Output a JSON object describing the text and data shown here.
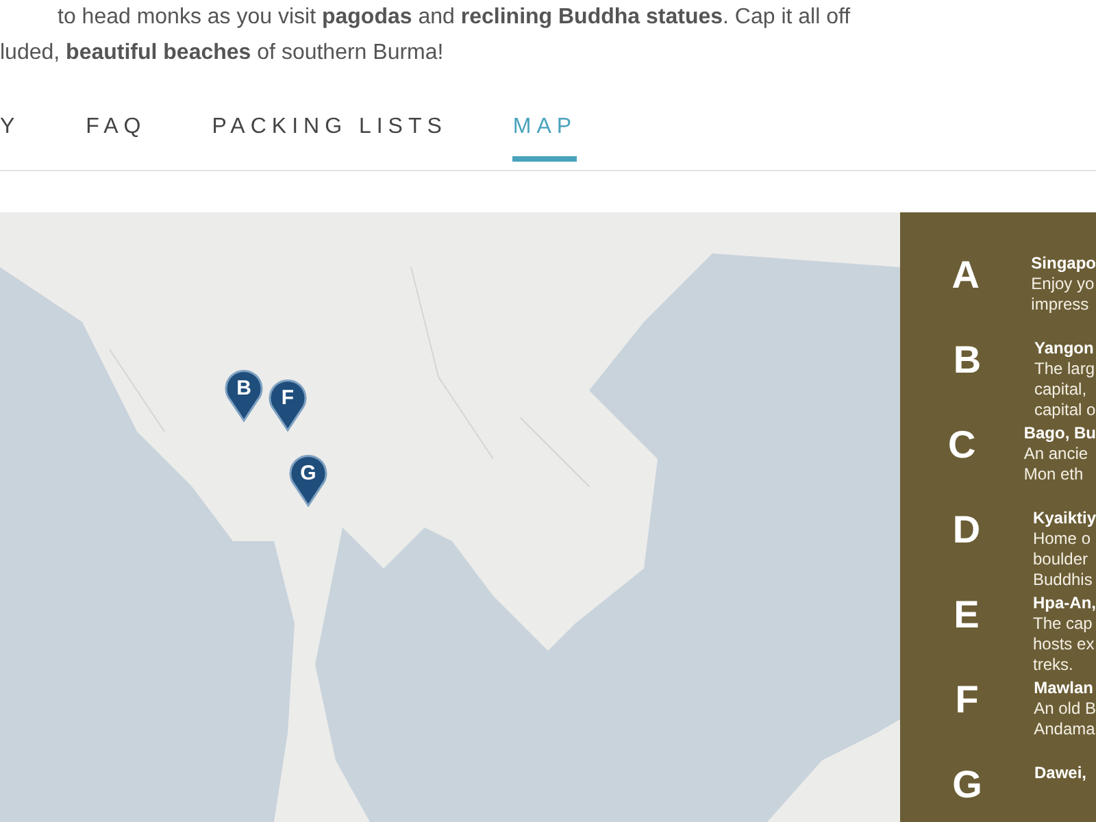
{
  "intro": [
    "to head monks as you visit **pagodas** and **reclining Buddha statues**.  Cap it all off",
    "luded, **beautiful beaches** of southern Burma!"
  ],
  "tabs": [
    {
      "label": "Y",
      "selected": false
    },
    {
      "label": "FAQ",
      "selected": false
    },
    {
      "label": "PACKING LISTS",
      "selected": false
    },
    {
      "label": "MAP",
      "selected": true
    }
  ],
  "map": {
    "kind": "picture",
    "pins": [
      {
        "label": "B"
      },
      {
        "label": "F"
      },
      {
        "label": "G"
      }
    ]
  },
  "stops": [
    {
      "letter": "A",
      "title": "Singapo",
      "lines": [
        "Enjoy yo",
        "impress"
      ]
    },
    {
      "letter": "B",
      "title": "Yangon",
      "lines": [
        "The larg",
        "capital,",
        "capital o"
      ]
    },
    {
      "letter": "C",
      "title": "Bago, Bu",
      "lines": [
        "An ancie",
        "Mon eth"
      ]
    },
    {
      "letter": "D",
      "title": "Kyaiktiy",
      "lines": [
        "Home o",
        "boulder",
        "Buddhis"
      ]
    },
    {
      "letter": "E",
      "title": "Hpa-An,",
      "lines": [
        "The cap",
        "hosts ex",
        "treks."
      ]
    },
    {
      "letter": "F",
      "title": "Mawlan",
      "lines": [
        "An old B",
        "Andama"
      ]
    },
    {
      "letter": "G",
      "title": "Dawei,"
    }
  ]
}
